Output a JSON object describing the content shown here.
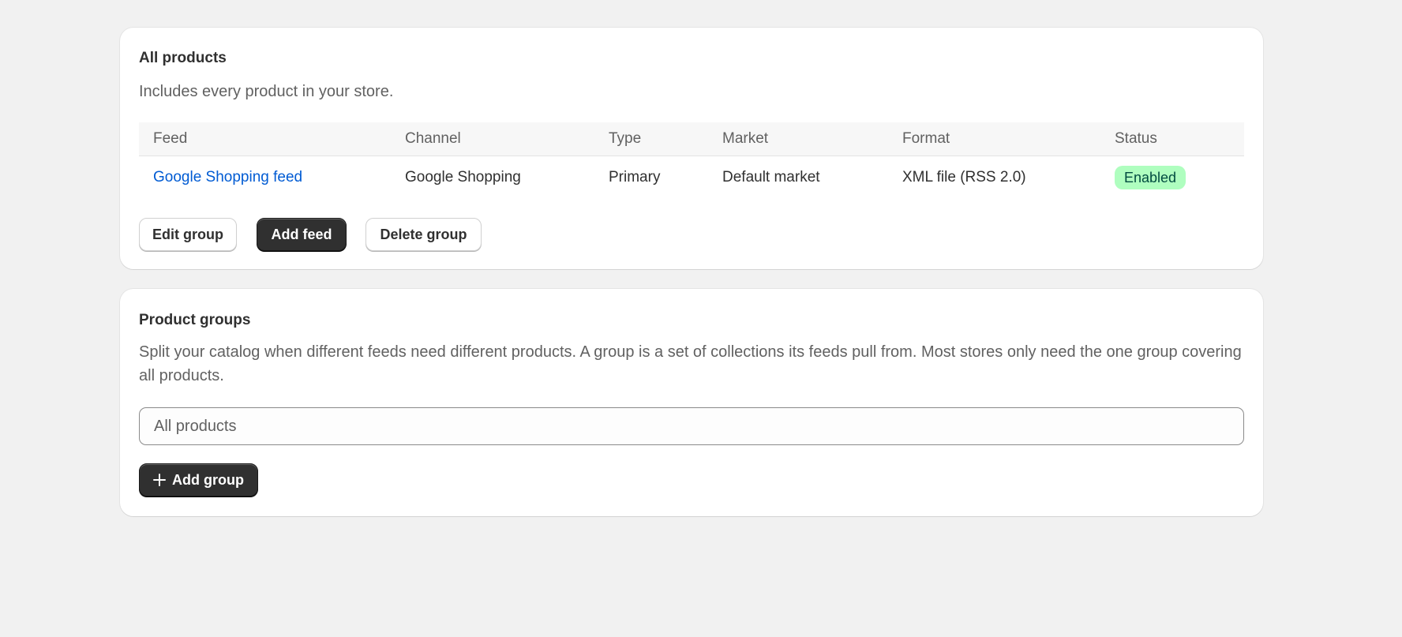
{
  "all_products": {
    "title": "All products",
    "description": "Includes every product in your store.",
    "table": {
      "headers": [
        "Feed",
        "Channel",
        "Type",
        "Market",
        "Format",
        "Status"
      ],
      "rows": [
        {
          "feed": "Google Shopping feed",
          "channel": "Google Shopping",
          "type": "Primary",
          "market": "Default market",
          "format": "XML file (RSS 2.0)",
          "status": "Enabled"
        }
      ]
    },
    "buttons": {
      "edit_group": "Edit group",
      "add_feed": "Add feed",
      "delete_group": "Delete group"
    }
  },
  "product_groups": {
    "title": "Product groups",
    "description": "Split your catalog when different feeds need different products. A group is a set of collections its feeds pull from. Most stores only need the one group covering all products.",
    "group_field_value": "All products",
    "add_group_label": "Add group",
    "add_group_icon": "plus-icon"
  },
  "colors": {
    "background": "#f1f1f1",
    "card": "#ffffff",
    "link": "#005bd3",
    "primary_button": "#303030",
    "badge_enabled_bg": "#affebf",
    "badge_enabled_text": "#014b40"
  }
}
